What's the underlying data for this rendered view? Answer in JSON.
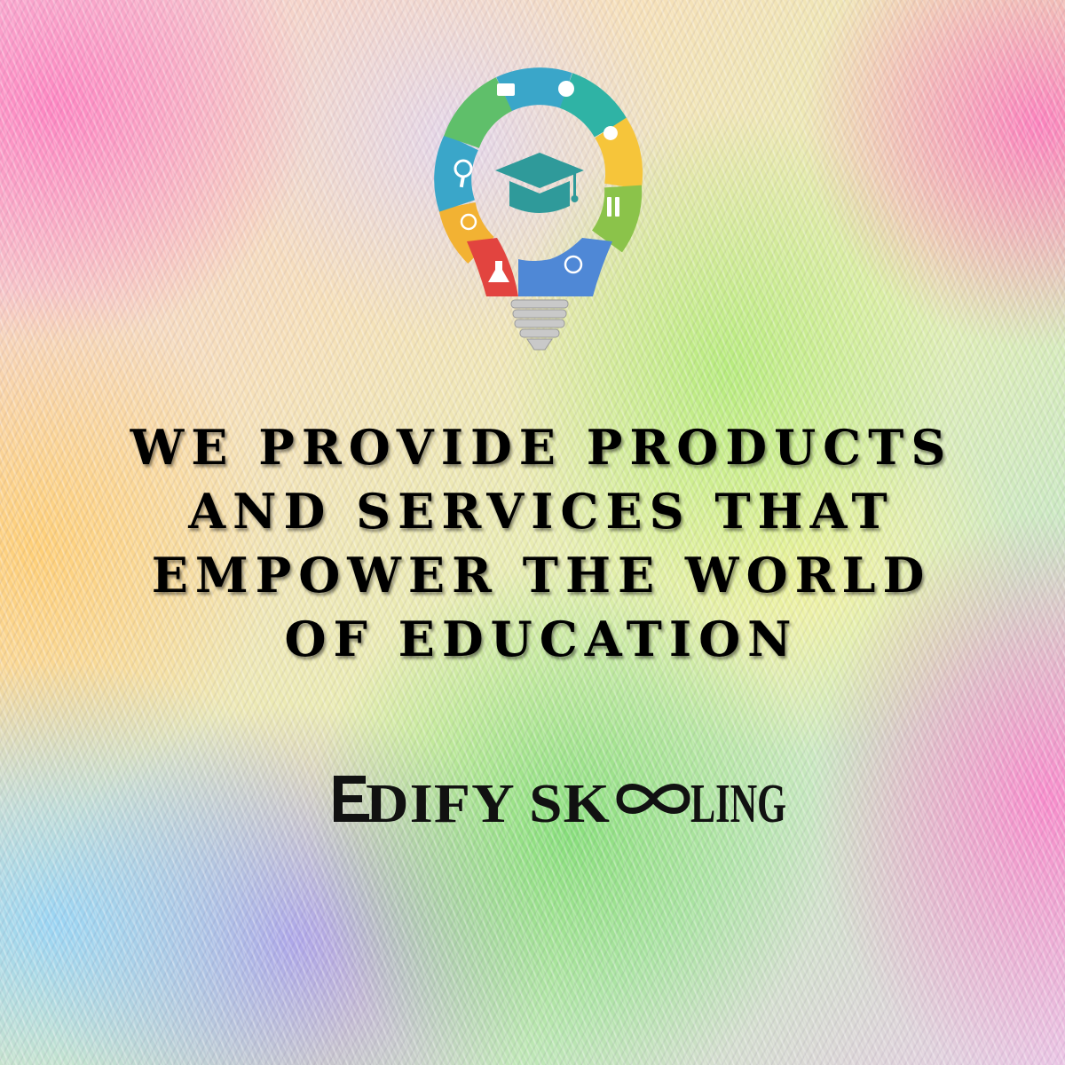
{
  "background": {
    "style": "rainbow brushed streaks",
    "colors": [
      "#ff78be",
      "#ffcd6e",
      "#78dc6e",
      "#af8ceb",
      "#8cd2ff"
    ]
  },
  "logo_icon": {
    "name": "lightbulb-graduation-cap-icon",
    "segment_colors": [
      "#3aa6c9",
      "#5fbf6a",
      "#2fb3a5",
      "#f2b233",
      "#8bc34a",
      "#e2443f",
      "#4f88d6",
      "#f6c53a",
      "#f5a623"
    ],
    "cap_color": "#2f9a9a"
  },
  "headline": {
    "lines": [
      "WE PROVIDE PRODUCTS",
      "AND SERVICES THAT",
      "EMPOWER THE WORLD",
      "OF EDUCATION"
    ]
  },
  "brand": {
    "name": "EDIFY SKOOLING"
  }
}
